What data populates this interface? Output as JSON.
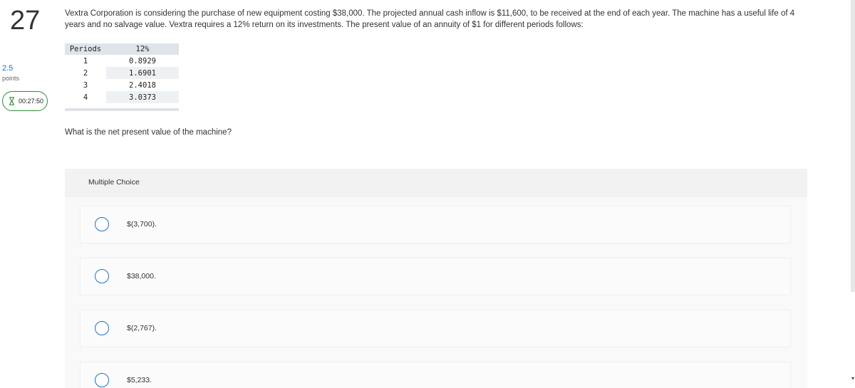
{
  "question": {
    "number": "27",
    "points_value": "2.5",
    "points_label": "points",
    "timer": "00:27:50",
    "text": "Vextra Corporation is considering the purchase of new equipment costing $38,000. The projected annual cash inflow is $11,600, to be received at the end of each year. The machine has a useful life of 4 years and no salvage value. Vextra requires a 12% return on its investments. The present value of an annuity of $1 for different periods follows:",
    "prompt": "What is the net present value of the machine?"
  },
  "pv_table": {
    "headers": [
      "Periods",
      "12%"
    ],
    "rows": [
      {
        "period": "1",
        "value": "0.8929"
      },
      {
        "period": "2",
        "value": "1.6901"
      },
      {
        "period": "3",
        "value": "2.4018"
      },
      {
        "period": "4",
        "value": "3.0373"
      }
    ]
  },
  "multiple_choice": {
    "label": "Multiple Choice",
    "options": [
      {
        "label": "$(3,700)."
      },
      {
        "label": "$38,000."
      },
      {
        "label": "$(2,767)."
      },
      {
        "label": "$5,233."
      }
    ]
  },
  "icons": {
    "timer": "hourglass-icon",
    "choice": "radio-circle-icon"
  },
  "colors": {
    "accent": "#1a73c8",
    "timer_border": "#2e8b3a"
  }
}
